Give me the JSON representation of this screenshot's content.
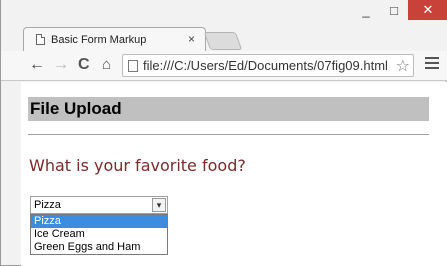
{
  "browser": {
    "tab_title": "Basic Form Markup",
    "tab_close": "×",
    "url": "file:///C:/Users/Ed/Documents/07fig09.html",
    "window_controls": {
      "minimize": "_",
      "maximize": "□",
      "close": "✕"
    },
    "icons": {
      "back": "←",
      "forward": "→",
      "reload": "C",
      "home": "⌂",
      "star": "☆"
    }
  },
  "page": {
    "heading": "File Upload",
    "question": "What is your favorite food?",
    "select": {
      "value": "Pizza",
      "arrow": "▾",
      "options": [
        "Pizza",
        "Ice Cream",
        "Green Eggs and Ham"
      ],
      "highlighted_option": "Pizza"
    }
  },
  "colors": {
    "heading_bg": "#c0c0c0",
    "question_text": "#7a2a2a",
    "option_highlight": "#3c8de0",
    "close_button": "#c9423a"
  }
}
